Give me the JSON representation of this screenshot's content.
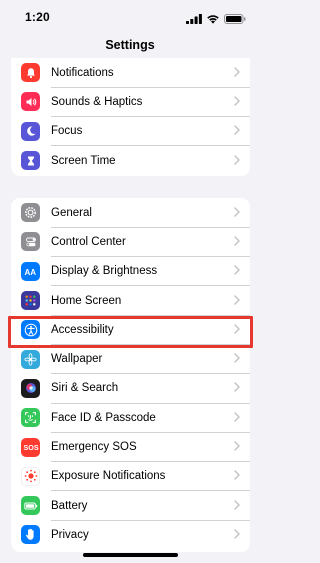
{
  "status_bar": {
    "time": "1:20"
  },
  "nav": {
    "title": "Settings"
  },
  "group1": [
    {
      "label": "Notifications",
      "icon": "bell-icon",
      "color": "#ff3b30"
    },
    {
      "label": "Sounds & Haptics",
      "icon": "speaker-icon",
      "color": "#ff2d55"
    },
    {
      "label": "Focus",
      "icon": "moon-icon",
      "color": "#5856d6"
    },
    {
      "label": "Screen Time",
      "icon": "hourglass-icon",
      "color": "#5856d6"
    }
  ],
  "group2": [
    {
      "label": "General",
      "icon": "gear-icon",
      "color": "#8e8e93"
    },
    {
      "label": "Control Center",
      "icon": "switches-icon",
      "color": "#8e8e93"
    },
    {
      "label": "Display & Brightness",
      "icon": "text-size-icon",
      "color": "#007aff"
    },
    {
      "label": "Home Screen",
      "icon": "app-grid-icon",
      "color": "#3a3a9e"
    },
    {
      "label": "Accessibility",
      "icon": "accessibility-icon",
      "color": "#007aff"
    },
    {
      "label": "Wallpaper",
      "icon": "flower-icon",
      "color": "#34aadc"
    },
    {
      "label": "Siri & Search",
      "icon": "siri-icon",
      "color": "#1c1c1e"
    },
    {
      "label": "Face ID & Passcode",
      "icon": "face-id-icon",
      "color": "#34c759"
    },
    {
      "label": "Emergency SOS",
      "icon": "sos-icon",
      "color": "#ff3b30"
    },
    {
      "label": "Exposure Notifications",
      "icon": "exposure-icon",
      "color": "#ffffff"
    },
    {
      "label": "Battery",
      "icon": "battery-icon",
      "color": "#34c759"
    },
    {
      "label": "Privacy",
      "icon": "hand-icon",
      "color": "#007aff"
    }
  ],
  "highlight_color": "#e5392f"
}
